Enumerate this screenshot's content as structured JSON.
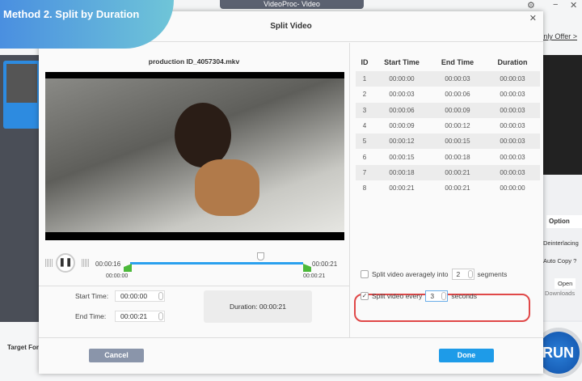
{
  "banner": "Method 2. Split by Duration",
  "app": {
    "title": "VideoProc- Video",
    "offer": "Only Offer >",
    "target": "Target For",
    "run": "RUN",
    "option": "Option",
    "deinterlacing": "Deinterlacing",
    "auto_copy": "Auto Copy ?",
    "open": "Open",
    "downloads": "Downloads"
  },
  "dialog": {
    "title": "Split Video",
    "filename": "production ID_4057304.mkv",
    "player": {
      "current": "00:00:16",
      "end_top": "00:00:21",
      "start_mark": "00:00:00",
      "end_mark": "00:00:21"
    },
    "start_label": "Start Time:",
    "start_value": "00:00:00",
    "end_label": "End Time:",
    "end_value": "00:00:21",
    "duration": "Duration:  00:00:21",
    "table": {
      "headers": [
        "ID",
        "Start Time",
        "End Time",
        "Duration"
      ],
      "rows": [
        [
          "1",
          "00:00:00",
          "00:00:03",
          "00:00:03"
        ],
        [
          "2",
          "00:00:03",
          "00:00:06",
          "00:00:03"
        ],
        [
          "3",
          "00:00:06",
          "00:00:09",
          "00:00:03"
        ],
        [
          "4",
          "00:00:09",
          "00:00:12",
          "00:00:03"
        ],
        [
          "5",
          "00:00:12",
          "00:00:15",
          "00:00:03"
        ],
        [
          "6",
          "00:00:15",
          "00:00:18",
          "00:00:03"
        ],
        [
          "7",
          "00:00:18",
          "00:00:21",
          "00:00:03"
        ],
        [
          "8",
          "00:00:21",
          "00:00:21",
          "00:00:00"
        ]
      ]
    },
    "opt1": {
      "label": "Split video averagely into",
      "value": "2",
      "unit": "segments",
      "checked": false
    },
    "opt2": {
      "label": "Split video every",
      "value": "3",
      "unit": "seconds",
      "checked": true
    },
    "cancel": "Cancel",
    "done": "Done"
  },
  "colors": {
    "accent": "#2aa0ee",
    "done": "#1e9be8",
    "cancel": "#8a95aa",
    "highlight": "#e04848"
  }
}
